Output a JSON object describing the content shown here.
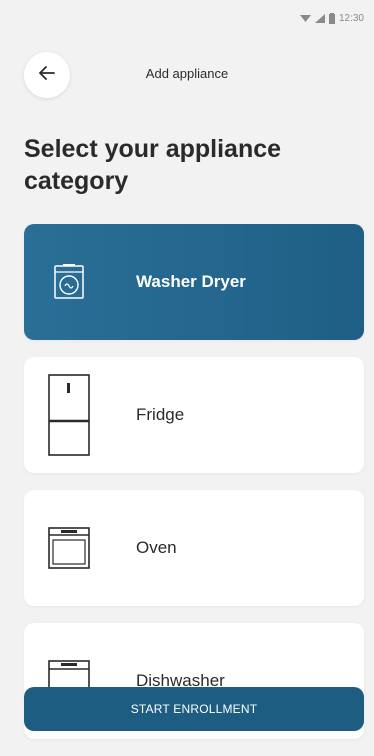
{
  "status_bar": {
    "time": "12:30"
  },
  "header": {
    "title": "Add appliance"
  },
  "page": {
    "title": "Select your appliance category"
  },
  "categories": [
    {
      "label": "Washer Dryer",
      "icon": "washer-dryer-icon",
      "selected": true
    },
    {
      "label": "Fridge",
      "icon": "fridge-icon",
      "selected": false
    },
    {
      "label": "Oven",
      "icon": "oven-icon",
      "selected": false
    },
    {
      "label": "Dishwasher",
      "icon": "dishwasher-icon",
      "selected": false
    }
  ],
  "actions": {
    "start_label": "START ENROLLMENT"
  },
  "colors": {
    "accent": "#1f5f86",
    "button": "#1d5d82",
    "background": "#f2f2f2"
  }
}
